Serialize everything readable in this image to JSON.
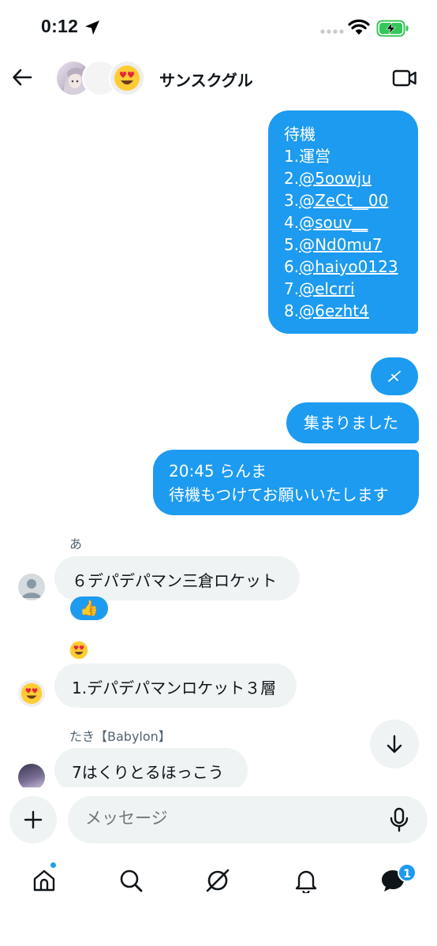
{
  "status_bar": {
    "time": "0:12"
  },
  "header": {
    "title": "サンスクグル"
  },
  "messages": {
    "list": [
      "待機",
      "1.運営",
      "2.",
      "@5oowju",
      "3.",
      "@ZeCt__00",
      "4.",
      "@souv__",
      "5.",
      "@Nd0mu7",
      "6.",
      "@haiyo0123",
      "7.",
      "@elcrri",
      "8.",
      "@6ezht4"
    ],
    "gathered": "集まりました",
    "notice_line1": "20:45 らんま",
    "notice_line2": "待機もつけてお願いいたします"
  },
  "incoming": [
    {
      "sender": "あ",
      "text": "６デパデパマン三倉ロケット",
      "reaction": "👍"
    },
    {
      "sender": "😍",
      "text": "1.デパデパマンロケット３層"
    },
    {
      "sender": "たき【Babylon】",
      "text": "7はくりとるほっこう"
    }
  ],
  "composer": {
    "placeholder": "メッセージ"
  },
  "tabbar": {
    "messages_badge": "1"
  },
  "colors": {
    "accent": "#1d9bf0",
    "bubble_in": "#eff3f4",
    "text": "#0f1419",
    "muted": "#536471"
  }
}
